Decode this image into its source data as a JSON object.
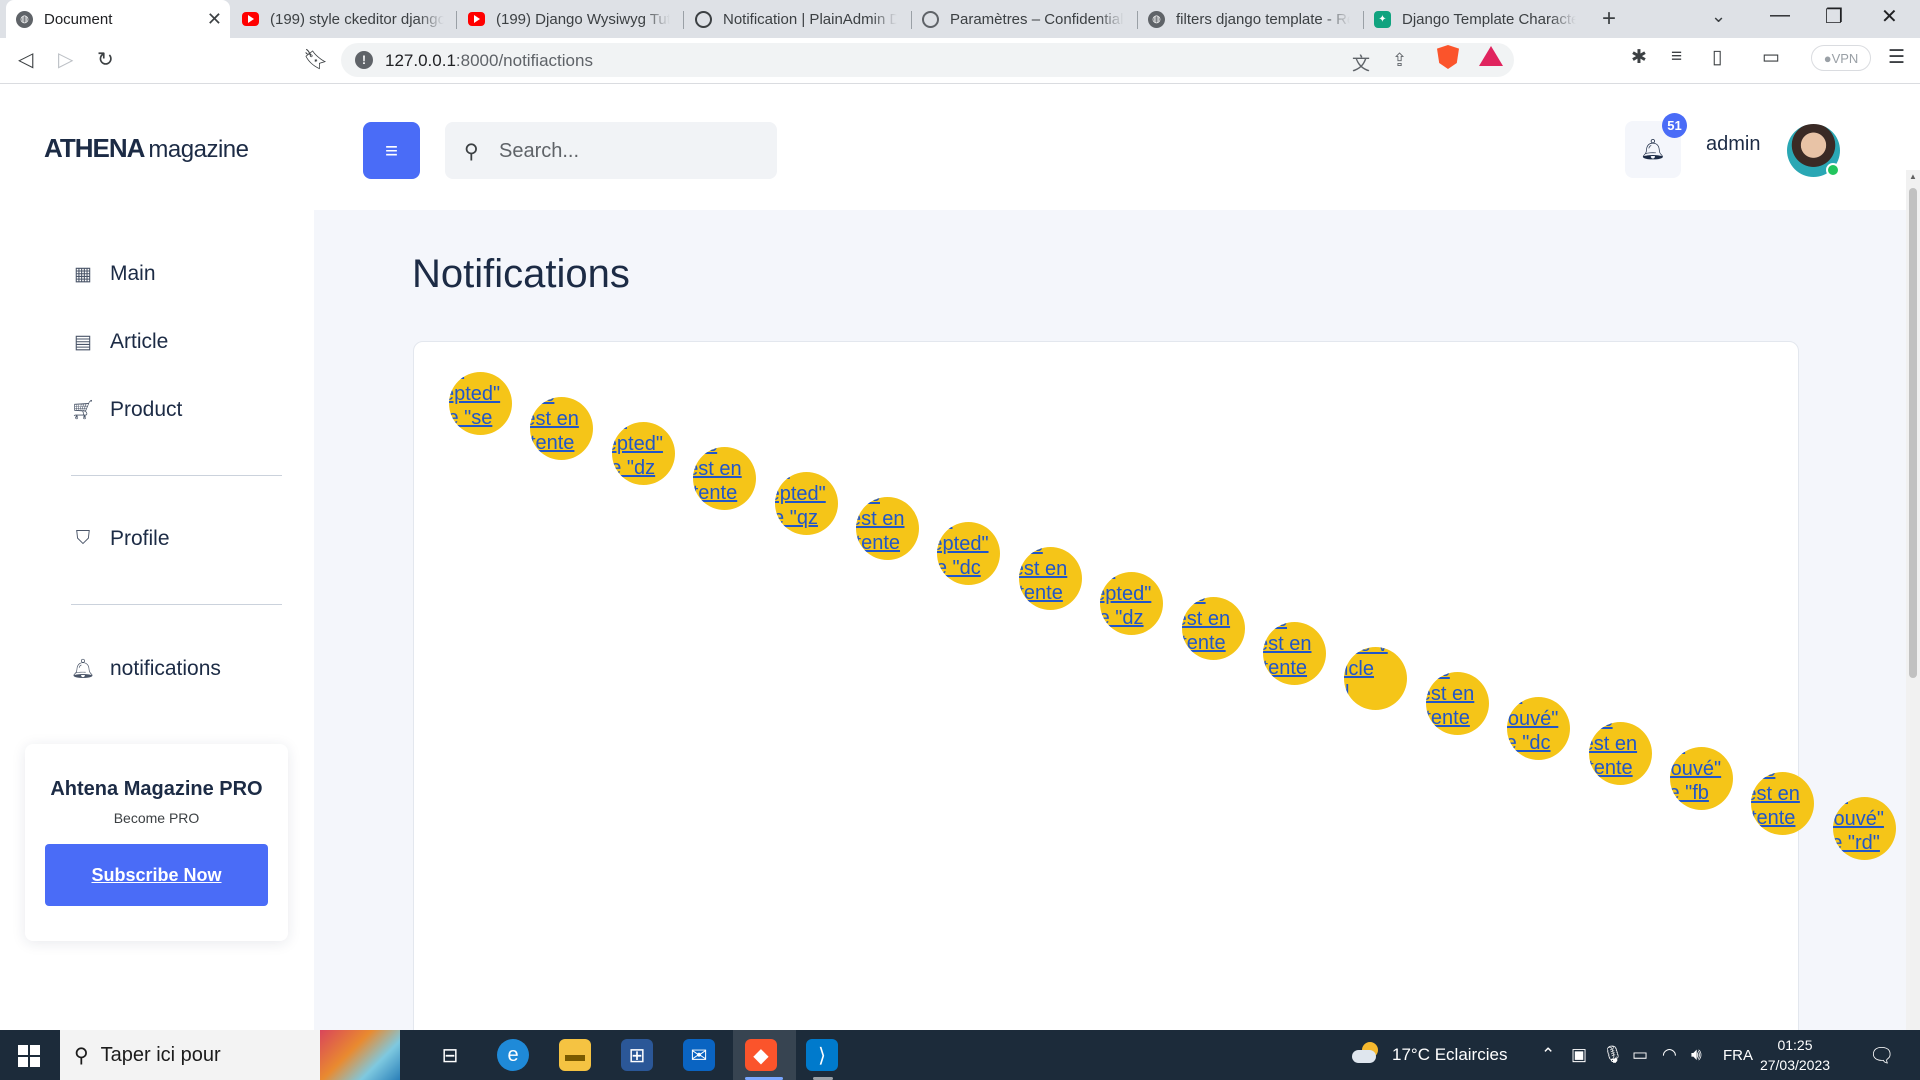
{
  "browser": {
    "tabs": [
      {
        "title": "Document",
        "icon": "globe-icon",
        "active": true
      },
      {
        "title": "(199) style ckeditor django",
        "icon": "youtube-icon",
        "active": false
      },
      {
        "title": "(199) Django Wysiwyg Tuto",
        "icon": "youtube-icon",
        "active": false
      },
      {
        "title": "Notification | PlainAdmin D",
        "icon": "ring-icon",
        "active": false
      },
      {
        "title": "Paramètres – Confidentialit",
        "icon": "gear-icon",
        "active": false
      },
      {
        "title": "filters django template - Re",
        "icon": "globe-icon",
        "active": false
      },
      {
        "title": "Django Template Character",
        "icon": "chatgpt-icon",
        "active": false
      }
    ],
    "url_host": "127.0.0.1",
    "url_path": ":8000/notifiactions",
    "vpn_label": "VPN"
  },
  "sidebar": {
    "logo_main": "ATHENA",
    "logo_sub": "magazine",
    "nav": [
      {
        "label": "Main",
        "icon": "grid-icon"
      },
      {
        "label": "Article",
        "icon": "article-icon"
      },
      {
        "label": "Product",
        "icon": "cart-icon"
      },
      {
        "label": "Profile",
        "icon": "shield-user-icon"
      },
      {
        "label": "notifications",
        "icon": "bell-icon"
      }
    ],
    "promo": {
      "title": "Ahtena Magazine PRO",
      "subtitle": "Become PRO",
      "button": "Subscribe Now"
    }
  },
  "header": {
    "search_placeholder": "Search...",
    "notification_count": "51",
    "username": "admin"
  },
  "main": {
    "title": "Notifications",
    "notifications": [
      {
        "text": "i a\nepted\"\nle \"se"
      },
      {
        "text": "ctic\nest en\nttente"
      },
      {
        "text": "i a\nepted\"\nle \"dz"
      },
      {
        "text": "ctic\nest en\nttente"
      },
      {
        "text": "i a\nepted\"\nle \"qz"
      },
      {
        "text": "ctic\nest en\nttente"
      },
      {
        "text": "i a\nepted\"\nle \"dc"
      },
      {
        "text": "ctic\nest en\nttente"
      },
      {
        "text": "i a\nepted\"\nle \"dz"
      },
      {
        "text": "ctic\nest en\nttente"
      },
      {
        "text": "ctic\nest en\nttente"
      },
      {
        "text": "usé\"v\nticle\nd"
      },
      {
        "text": "ctic\nest en\nttente"
      },
      {
        "text": "i a\nrouvé\"\nle \"dc"
      },
      {
        "text": "ctic\nest en\nttente"
      },
      {
        "text": "i a\nrouvé\"\nle \"fb"
      },
      {
        "text": "ctic\nest en\nttente"
      },
      {
        "text": "i a\nrouvé\"\nle \"rd\""
      }
    ]
  },
  "taskbar": {
    "search_text": "Taper ici pour",
    "weather": "17°C  Eclaircies",
    "language": "FRA",
    "time": "01:25",
    "date": "27/03/2023"
  }
}
